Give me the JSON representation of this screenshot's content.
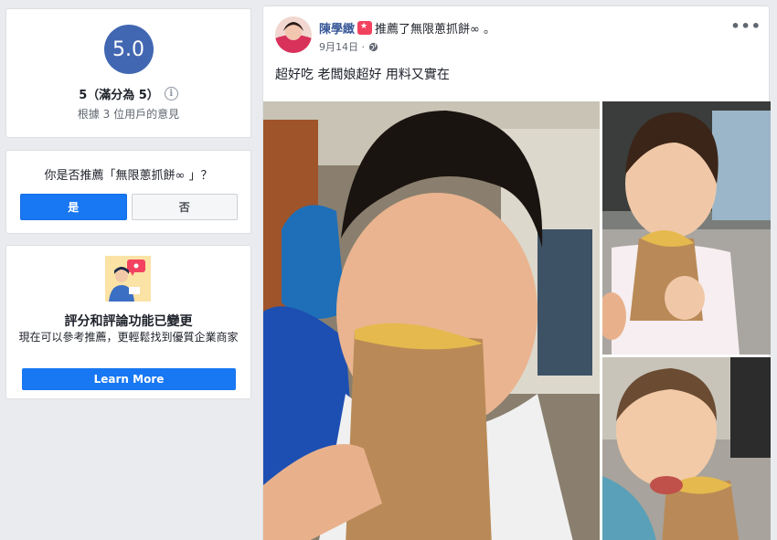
{
  "rating_card": {
    "score": "5.0",
    "summary": "5（滿分為 5）",
    "info_icon": "i",
    "basis": "根據 3 位用戶的意見"
  },
  "recommend_card": {
    "question": "你是否推薦「無限蔥抓餅∞ 」？",
    "yes_label": "是",
    "no_label": "否"
  },
  "change_card": {
    "title": "評分和評論功能已變更",
    "description": "現在可以參考推薦，更輕鬆找到優質企業商家",
    "button_label": "Learn More"
  },
  "post": {
    "author": "陳學緻",
    "action": "推薦了無限蔥抓餅∞ 。",
    "date": "9月14日 ·",
    "more_label": "•••",
    "text": "超好吃 老闆娘超好 用料又實在"
  },
  "colors": {
    "accent": "#1877f2",
    "rating_circle": "#4267b2",
    "author_link": "#385898",
    "badge": "#f3425f"
  },
  "icons": [
    "info-icon",
    "recommend-badge-icon",
    "globe-icon",
    "more-icon"
  ]
}
